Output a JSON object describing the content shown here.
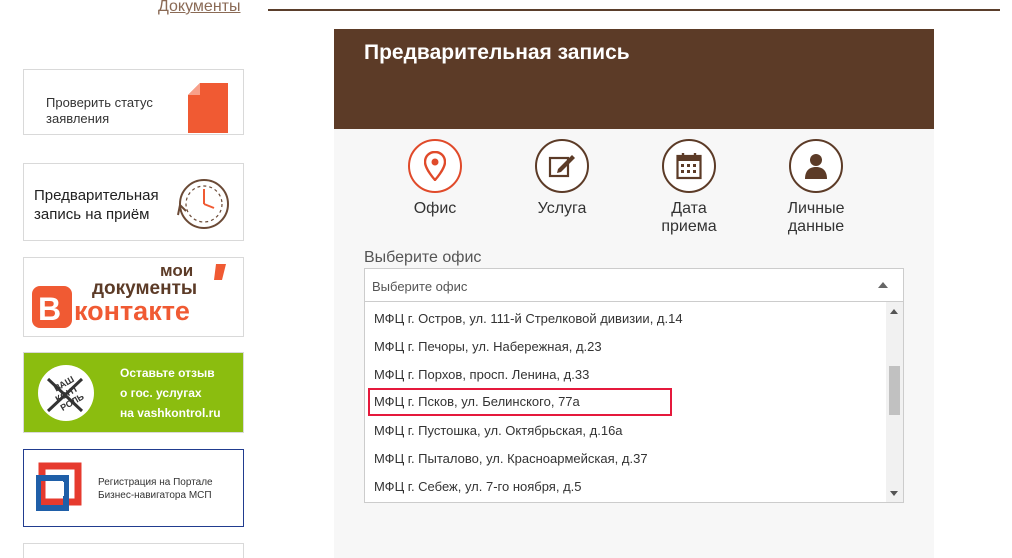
{
  "top_nav": {
    "documents_link": "Документы"
  },
  "sidebar": {
    "check_status": "Проверить статус заявления",
    "appointment": "Предварительная запись на приём",
    "vk_banner": {
      "line1": "мои",
      "line2": "документы",
      "line3": "контакте",
      "letter": "В"
    },
    "feedback_banner": {
      "line1": "Оставьте отзыв",
      "line2": "о гос. услугах",
      "line3": "на vashkontrol.ru",
      "logo_text": "ВАШ КОНТ РОЛЬ"
    },
    "business_banner": {
      "line1": "Регистрация на Портале",
      "line2": "Бизнес-навигатора МСП"
    }
  },
  "panel": {
    "title": "Предварительная запись",
    "steps": [
      {
        "label": "Офис",
        "icon": "location-pin-icon"
      },
      {
        "label": "Услуга",
        "icon": "pencil-edit-icon"
      },
      {
        "label": "Дата приема",
        "icon": "calendar-icon"
      },
      {
        "label": "Личные данные",
        "icon": "person-icon"
      }
    ],
    "office_label": "Выберите офис",
    "office_placeholder": "Выберите офис",
    "options": [
      "МФЦ г. Остров, ул. 111-й Стрелковой дивизии, д.14",
      "МФЦ г. Печоры, ул. Набережная, д.23",
      "МФЦ г. Порхов, просп. Ленина, д.33",
      "МФЦ г. Псков, ул. Белинского, 77а",
      "МФЦ г. Пустошка, ул. Октябрьская, д.16а",
      "МФЦ г. Пыталово, ул. Красноармейская, д.37",
      "МФЦ г. Себеж, ул. 7-го ноября, д.5"
    ],
    "highlighted_option_index": 3
  },
  "colors": {
    "brand_brown": "#5c3b27",
    "accent_red": "#e04a2a",
    "highlight_border": "#e5193c",
    "green_banner": "#8bbd0f"
  }
}
